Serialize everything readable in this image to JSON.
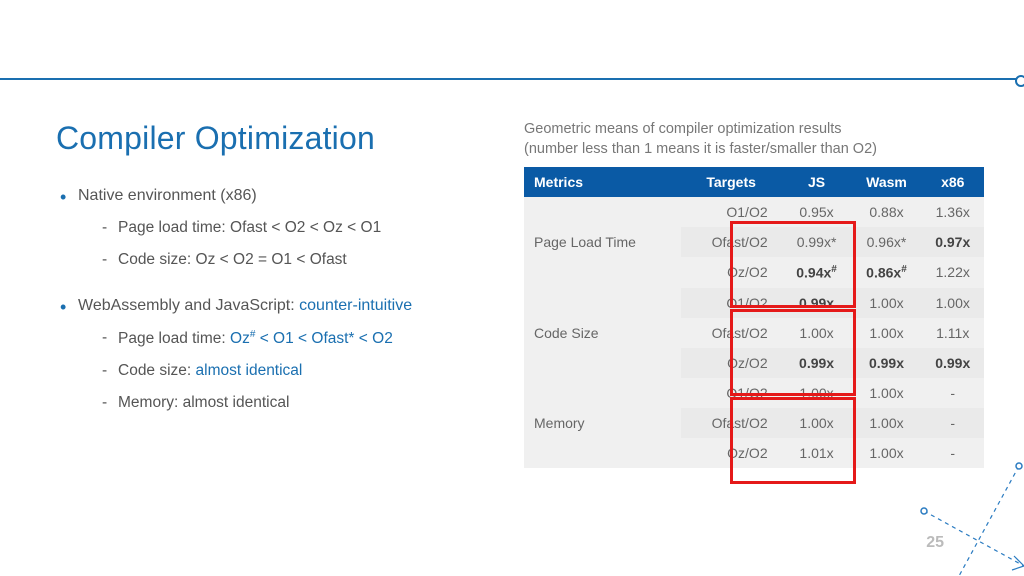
{
  "title": "Compiler Optimization",
  "bullets": [
    {
      "head": "Native environment (x86)",
      "items": [
        {
          "pre": "Page load time: ",
          "hl": "",
          "body": "Ofast < O2 < Oz < O1"
        },
        {
          "pre": "Code size: ",
          "hl": "",
          "body": "Oz < O2 = O1 < Ofast"
        }
      ]
    },
    {
      "head_pre": "WebAssembly and JavaScript: ",
      "head_hl": "counter-intuitive",
      "items": [
        {
          "pre": "Page load time: ",
          "hl": "Oz# < O1 < Ofast* < O2",
          "body": ""
        },
        {
          "pre": "Code size: ",
          "hl": "almost identical",
          "body": ""
        },
        {
          "pre": "Memory: almost identical",
          "hl": "",
          "body": ""
        }
      ]
    }
  ],
  "caption_l1": "Geometric means of compiler optimization results",
  "caption_l2": "(number less than 1 means it is faster/smaller than O2)",
  "headers": [
    "Metrics",
    "Targets",
    "JS",
    "Wasm",
    "x86"
  ],
  "groups": [
    {
      "metric": "Page Load Time",
      "rows": [
        {
          "tgt": "O1/O2",
          "js": "0.95x",
          "wasm": "0.88x",
          "x86": "1.36x"
        },
        {
          "tgt": "Ofast/O2",
          "js": "0.99x*",
          "wasm": "0.96x*",
          "x86": "0.97x",
          "bold_x86": true
        },
        {
          "tgt": "Oz/O2",
          "js": "0.94x#",
          "wasm": "0.86x#",
          "x86": "1.22x",
          "bold_js": true,
          "bold_wasm": true
        }
      ]
    },
    {
      "metric": "Code Size",
      "rows": [
        {
          "tgt": "O1/O2",
          "js": "0.99x",
          "wasm": "1.00x",
          "x86": "1.00x",
          "bold_js": true
        },
        {
          "tgt": "Ofast/O2",
          "js": "1.00x",
          "wasm": "1.00x",
          "x86": "1.11x"
        },
        {
          "tgt": "Oz/O2",
          "js": "0.99x",
          "wasm": "0.99x",
          "x86": "0.99x",
          "bold_js": true,
          "bold_wasm": true,
          "bold_x86": true
        }
      ]
    },
    {
      "metric": "Memory",
      "rows": [
        {
          "tgt": "O1/O2",
          "js": "1.00x",
          "wasm": "1.00x",
          "x86": "-"
        },
        {
          "tgt": "Ofast/O2",
          "js": "1.00x",
          "wasm": "1.00x",
          "x86": "-"
        },
        {
          "tgt": "Oz/O2",
          "js": "1.01x",
          "wasm": "1.00x",
          "x86": "-"
        }
      ]
    }
  ],
  "pagenum": "25"
}
